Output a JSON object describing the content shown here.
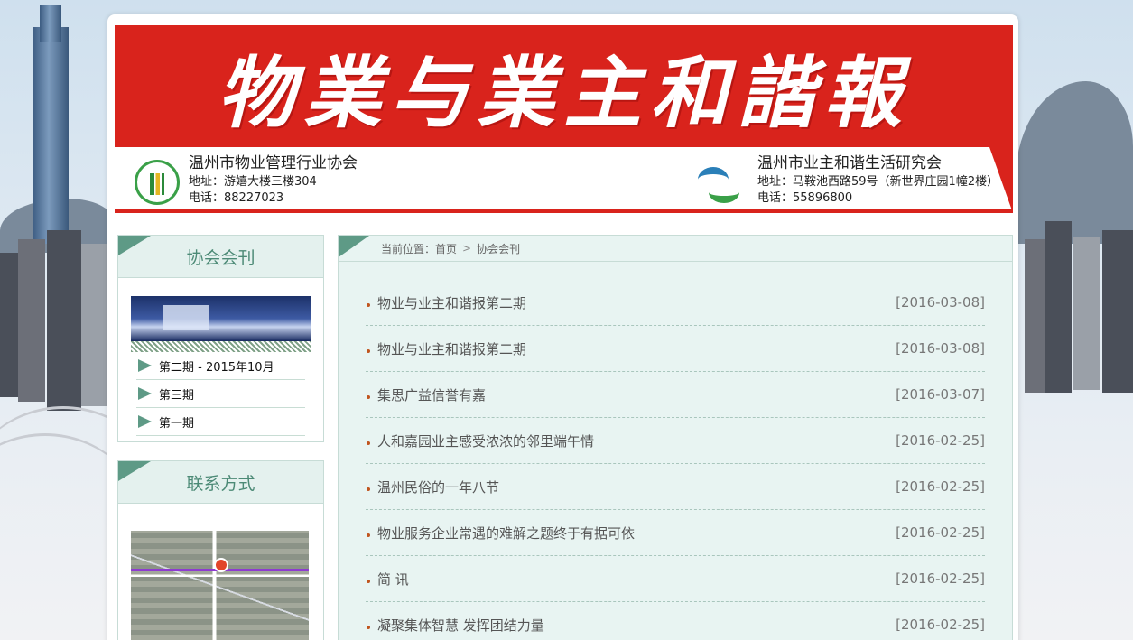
{
  "header": {
    "banner_title": "物業与業主和諧報",
    "org_left": {
      "name": "温州市物业管理行业协会",
      "address": "地址：游嬉大楼三楼304",
      "phone": "电话：88227023"
    },
    "org_right": {
      "name": "温州市业主和谐生活研究会",
      "address": "地址：马鞍池西路59号（新世界庄园1幢2楼）",
      "phone": "电话：55896800"
    }
  },
  "sidebar": {
    "journal_panel": {
      "title": "协会会刊",
      "items": [
        {
          "label": "第二期 - 2015年10月"
        },
        {
          "label": "第三期"
        },
        {
          "label": "第一期"
        }
      ]
    },
    "contact_panel": {
      "title": "联系方式"
    }
  },
  "breadcrumb": {
    "prefix": "当前位置：",
    "home": "首页",
    "separator": ">",
    "current": "协会会刊"
  },
  "news": [
    {
      "title": "物业与业主和谐报第二期",
      "date": "[2016-03-08]"
    },
    {
      "title": "物业与业主和谐报第二期",
      "date": "[2016-03-08]"
    },
    {
      "title": "集思广益信誉有嘉",
      "date": "[2016-03-07]"
    },
    {
      "title": "人和嘉园业主感受浓浓的邻里端午情",
      "date": "[2016-02-25]"
    },
    {
      "title": "温州民俗的一年八节",
      "date": "[2016-02-25]"
    },
    {
      "title": "物业服务企业常遇的难解之题终于有据可依",
      "date": "[2016-02-25]"
    },
    {
      "title": "简 讯",
      "date": "[2016-02-25]"
    },
    {
      "title": "凝聚集体智慧 发挥团结力量",
      "date": "[2016-02-25]"
    }
  ],
  "colors": {
    "banner_red": "#d9231c",
    "accent_green": "#5e9a86",
    "bullet_orange": "#c0541e"
  }
}
